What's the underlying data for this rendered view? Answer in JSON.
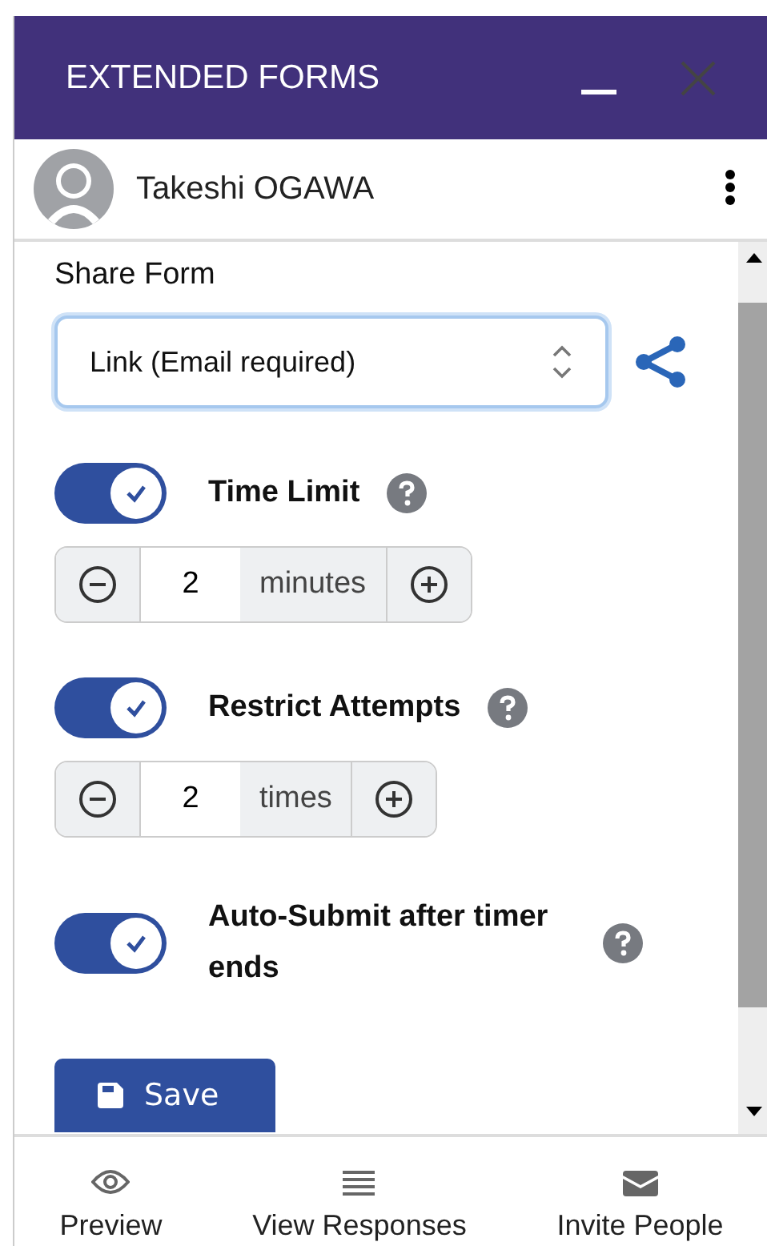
{
  "window": {
    "title": "EXTENDED FORMS"
  },
  "user": {
    "name": "Takeshi OGAWA"
  },
  "share": {
    "label": "Share Form",
    "value": "Link (Email required)"
  },
  "settings": [
    {
      "label": "Time Limit",
      "on": true,
      "stepper": {
        "value": "2",
        "unit": "minutes"
      }
    },
    {
      "label": "Restrict Attempts",
      "on": true,
      "stepper": {
        "value": "2",
        "unit": "times"
      }
    },
    {
      "label": "Auto-Submit after timer ends",
      "on": true
    }
  ],
  "save": {
    "label": "Save"
  },
  "nav": [
    {
      "label": "Preview",
      "kind": "eye"
    },
    {
      "label": "View Responses",
      "kind": "list"
    },
    {
      "label": "Invite People",
      "kind": "mail"
    }
  ]
}
